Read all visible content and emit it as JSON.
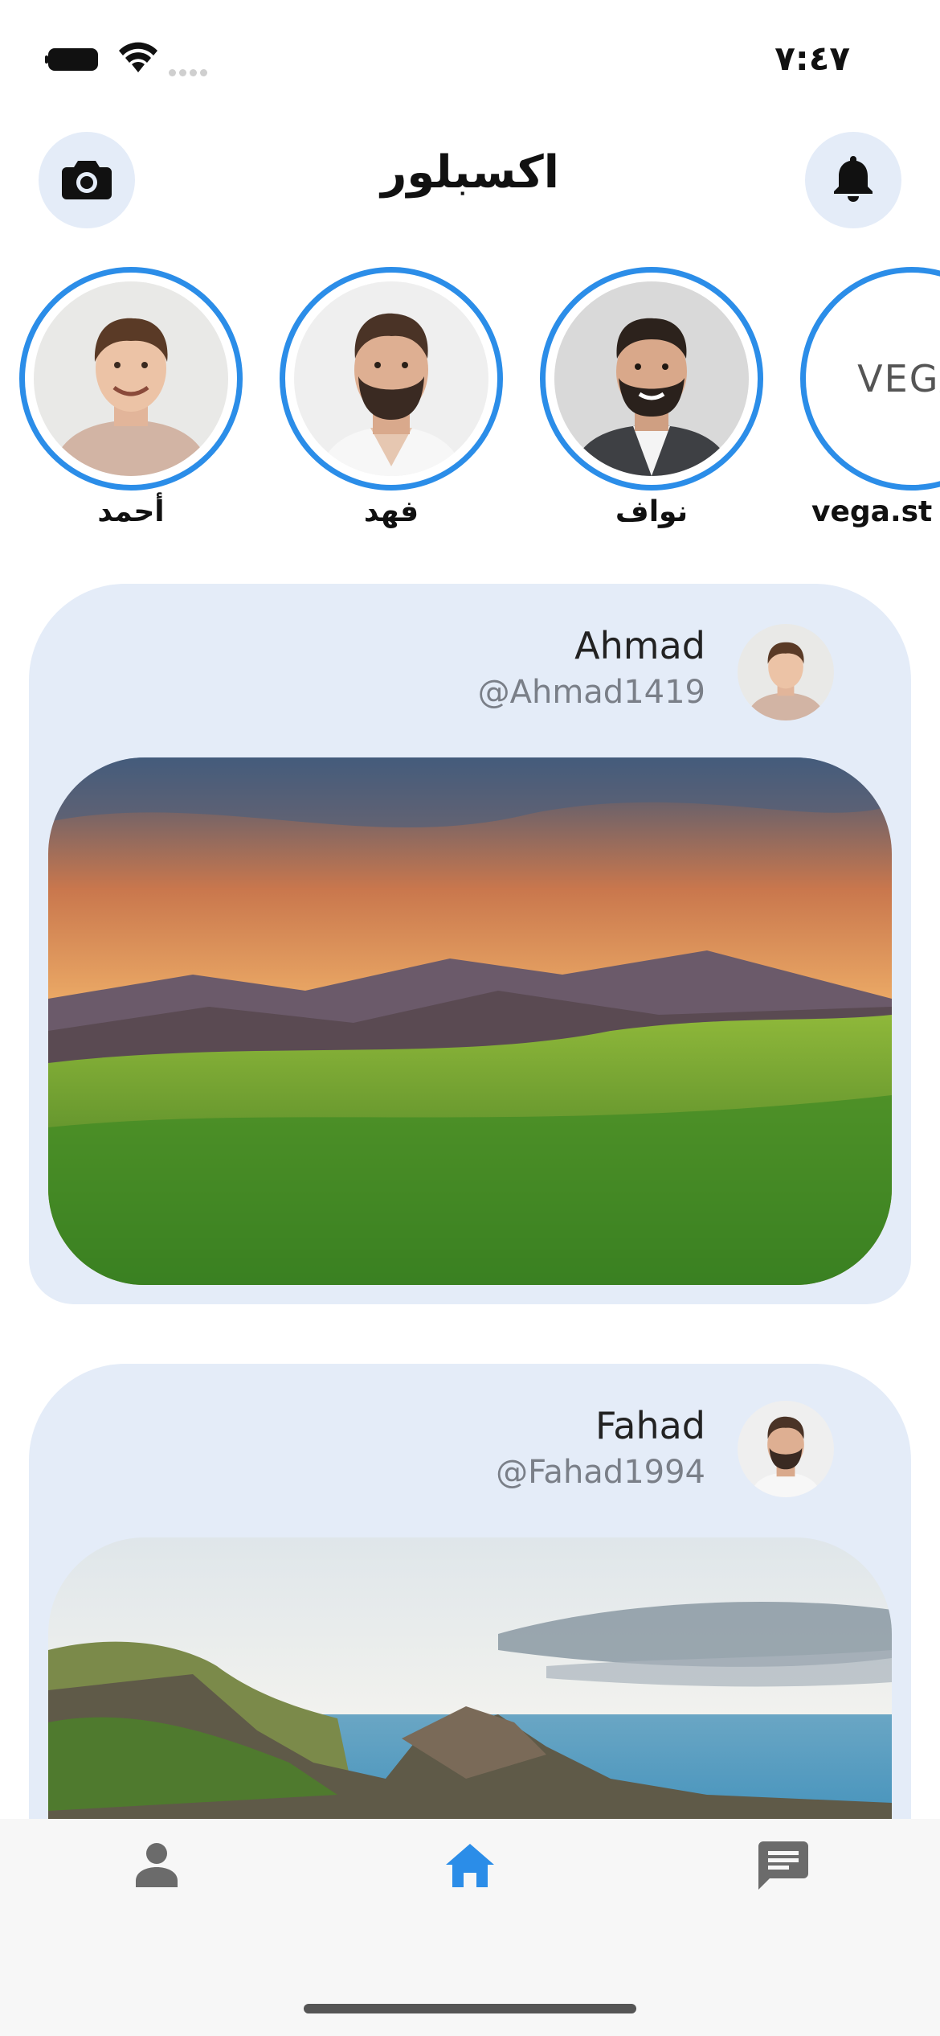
{
  "status_bar": {
    "time": "٧:٤٧"
  },
  "header": {
    "title": "اكسبلور",
    "camera_icon": "camera-icon",
    "bell_icon": "bell-icon"
  },
  "stories": [
    {
      "name": "أحمد",
      "avatar": "avatar-young-man-beige-sweater"
    },
    {
      "name": "فهد",
      "avatar": "avatar-bearded-man-white-shirt"
    },
    {
      "name": "نواف",
      "avatar": "avatar-man-suit"
    },
    {
      "name": "vega.st",
      "avatar": "vega-logo",
      "logo_text": "VEGA"
    }
  ],
  "posts": [
    {
      "author": "Ahmad",
      "handle": "@Ahmad1419",
      "image": "sunset-mountains-grass"
    },
    {
      "author": "Fahad",
      "handle": "@Fahad1994",
      "image": "coastal-cliffs-sea"
    }
  ],
  "tabbar": {
    "items": [
      {
        "icon": "person-icon",
        "active": false
      },
      {
        "icon": "home-icon",
        "active": true
      },
      {
        "icon": "chat-icon",
        "active": false
      }
    ]
  },
  "colors": {
    "accent": "#2b8de8",
    "card_bg": "#e4ecf8",
    "inactive_icon": "#6b6b6b"
  }
}
